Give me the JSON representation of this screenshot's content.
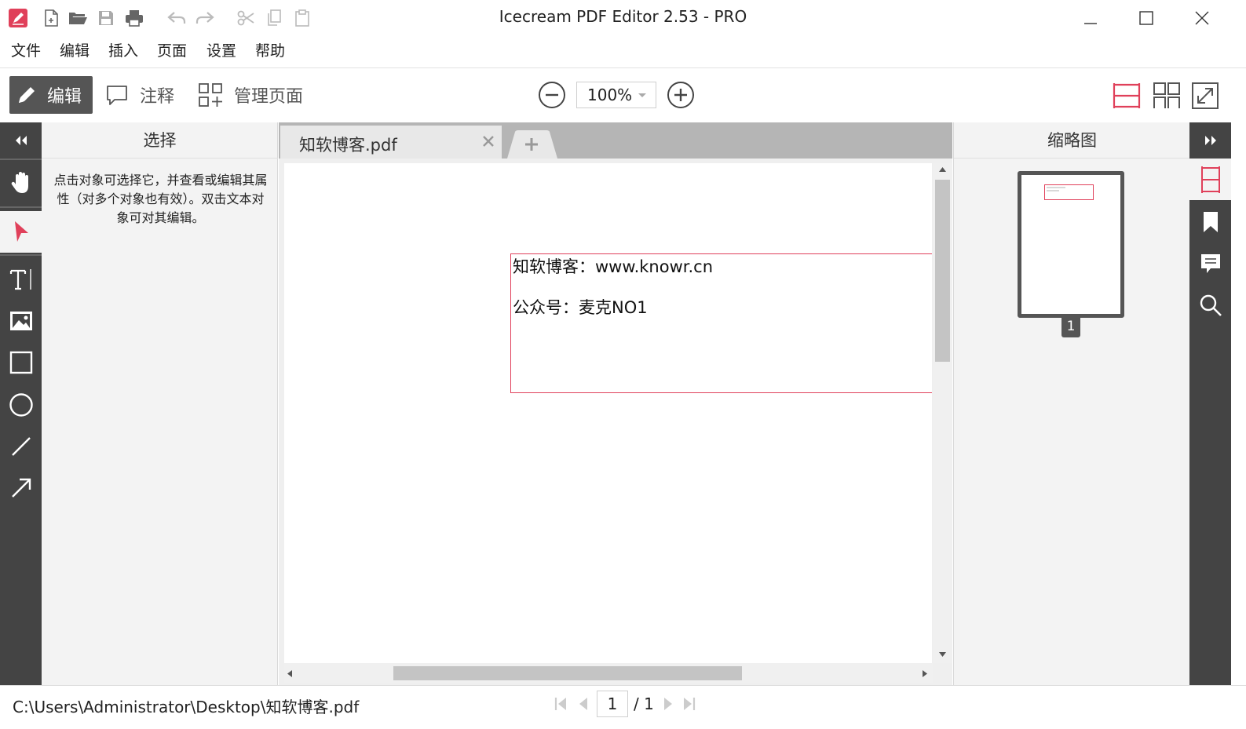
{
  "window": {
    "title": "Icecream PDF Editor 2.53 - PRO"
  },
  "menu": {
    "items": [
      "文件",
      "编辑",
      "插入",
      "页面",
      "设置",
      "帮助"
    ]
  },
  "toolbar": {
    "edit_label": "编辑",
    "annotate_label": "注释",
    "manage_pages_label": "管理页面",
    "zoom_value": "100%"
  },
  "left_panel": {
    "title": "选择",
    "description": "点击对象可选择它，并查看或编辑其属性（对多个对象也有效）。双击文本对象可对其编辑。"
  },
  "document": {
    "tab_name": "知软博客.pdf",
    "lines": [
      "知软博客：www.knowr.cn",
      "公众号：麦克NO1"
    ]
  },
  "right_panel": {
    "title": "缩略图",
    "page_number": "1"
  },
  "status": {
    "file_path": "C:\\Users\\Administrator\\Desktop\\知软博客.pdf",
    "current_page": "1",
    "total_pages": "/ 1"
  },
  "colors": {
    "accent": "#e0405a",
    "rail_bg": "#444444",
    "panel_bg": "#f3f3f3"
  }
}
